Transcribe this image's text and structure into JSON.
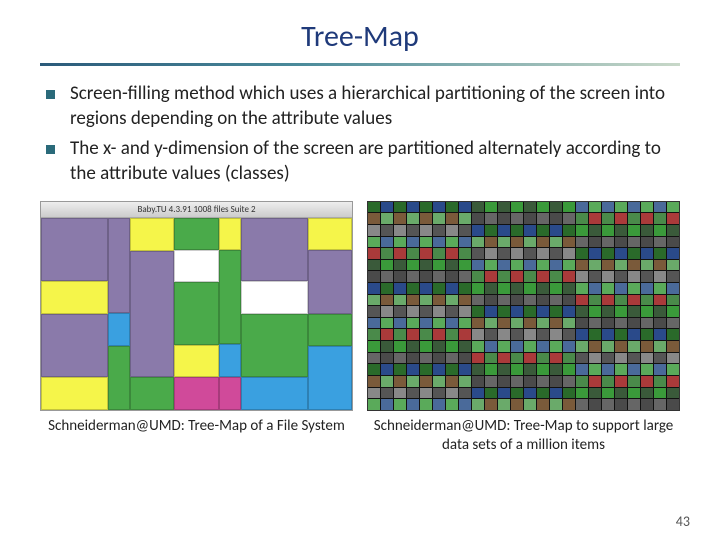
{
  "title": "Tree-Map",
  "bullets": [
    "Screen-filling method which uses a hierarchical partitioning of the screen into regions depending on the attribute values",
    "The x- and y-dimension of the screen are partitioned alternately according to the attribute values (classes)"
  ],
  "figure1": {
    "window_title": "Baby.TU 4.3.91 1008 files Suite 2",
    "caption": "Schneiderman@UMD: Tree-Map of a File System"
  },
  "figure2": {
    "caption": "Schneiderman@UMD: Tree-Map to support large data sets of a million items"
  },
  "page_number": "43",
  "colors": {
    "title": "#1f3a7a",
    "bullet_marker": "#2a6a7a"
  }
}
